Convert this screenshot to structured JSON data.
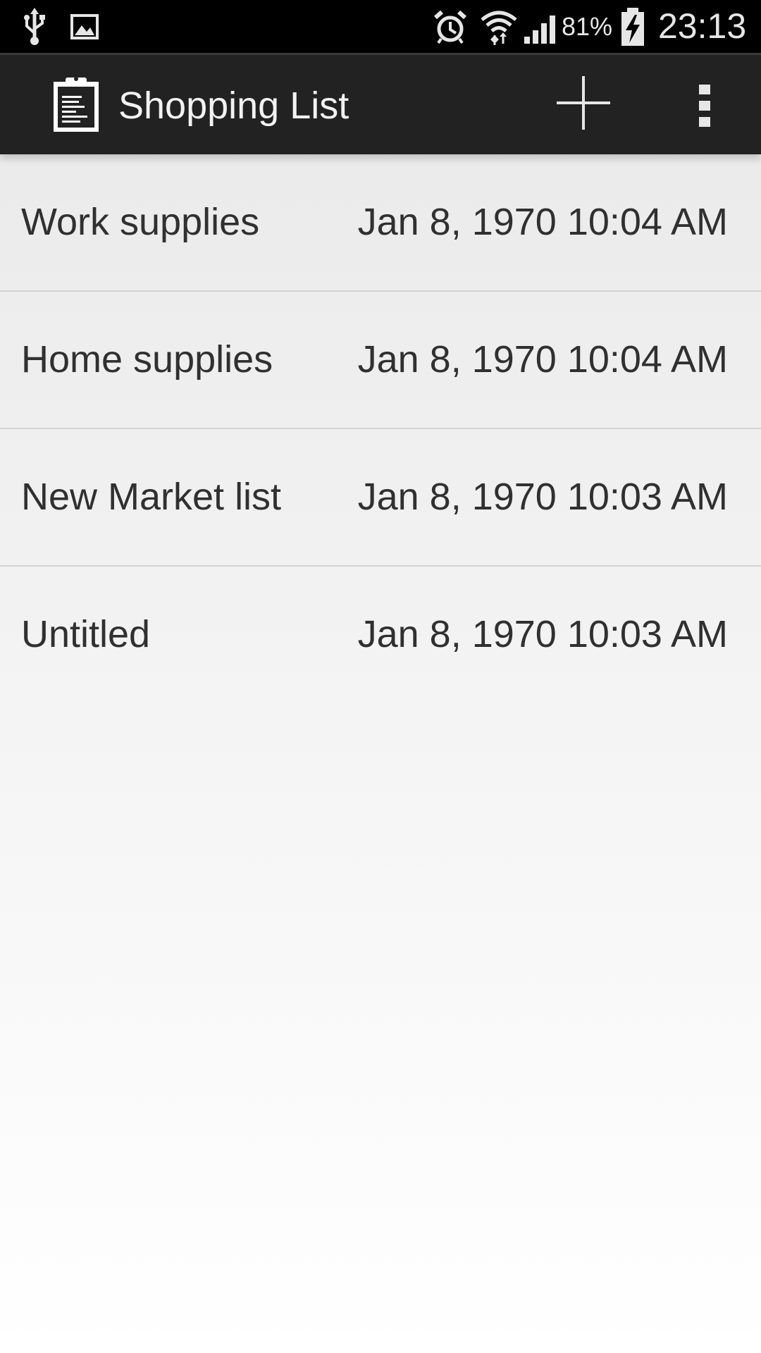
{
  "status_bar": {
    "icons_left": [
      "usb-icon",
      "image-notification-icon"
    ],
    "icons_right": [
      "alarm-icon",
      "wifi-icon",
      "signal-icon",
      "battery-charging-icon"
    ],
    "battery_percent": "81%",
    "time": "23:13"
  },
  "action_bar": {
    "app_icon": "clipboard-icon",
    "title": "Shopping List",
    "add_icon": "plus-icon",
    "overflow_icon": "overflow-menu-icon"
  },
  "lists": [
    {
      "name": "Work supplies",
      "date": "Jan 8, 1970 10:04 AM"
    },
    {
      "name": "Home supplies",
      "date": "Jan 8, 1970 10:04 AM"
    },
    {
      "name": "New Market list",
      "date": "Jan 8, 1970 10:03 AM"
    },
    {
      "name": "Untitled",
      "date": "Jan 8, 1970 10:03 AM"
    }
  ],
  "colors": {
    "status_bar_bg": "#000000",
    "action_bar_bg": "#222222",
    "text": "#303030",
    "divider": "#d3d3d3"
  }
}
